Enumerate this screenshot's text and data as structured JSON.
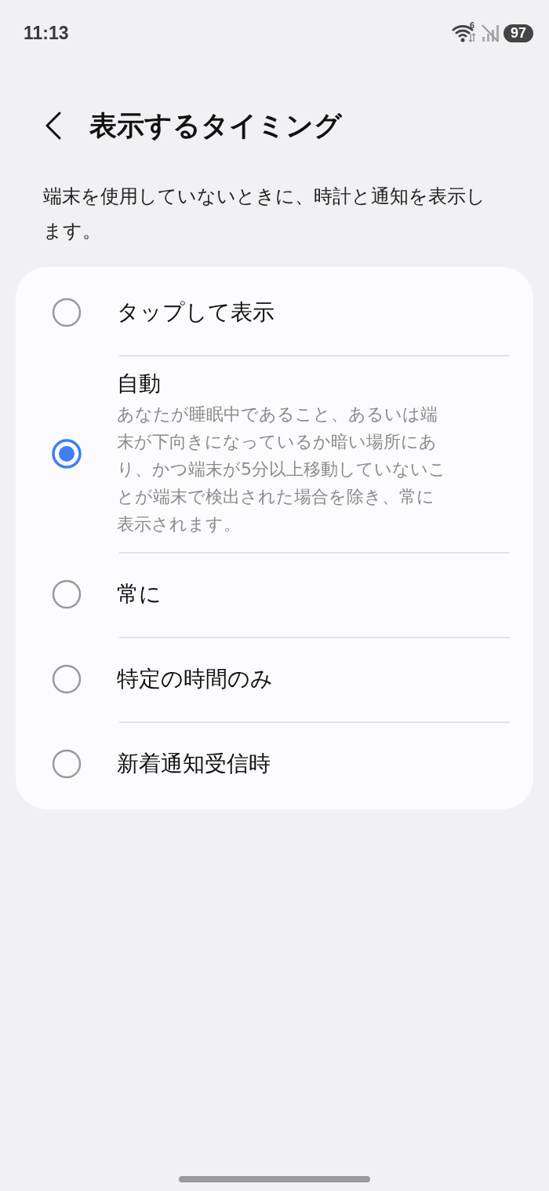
{
  "status_bar": {
    "time": "11:13",
    "wifi_badge": "6",
    "battery": "97"
  },
  "header": {
    "title": "表示するタイミング"
  },
  "description": "端末を使用していないときに、時計と通知を表示します。",
  "options": [
    {
      "label": "タップして表示",
      "selected": false
    },
    {
      "label": "自動",
      "selected": true,
      "summary": "あなたが睡眠中であること、あるいは端末が下向きになっているか暗い場所にあり、かつ端末が5分以上移動していないことが端末で検出された場合を除き、常に表示されます。"
    },
    {
      "label": "常に",
      "selected": false
    },
    {
      "label": "特定の時間のみ",
      "selected": false
    },
    {
      "label": "新着通知受信時",
      "selected": false
    }
  ]
}
